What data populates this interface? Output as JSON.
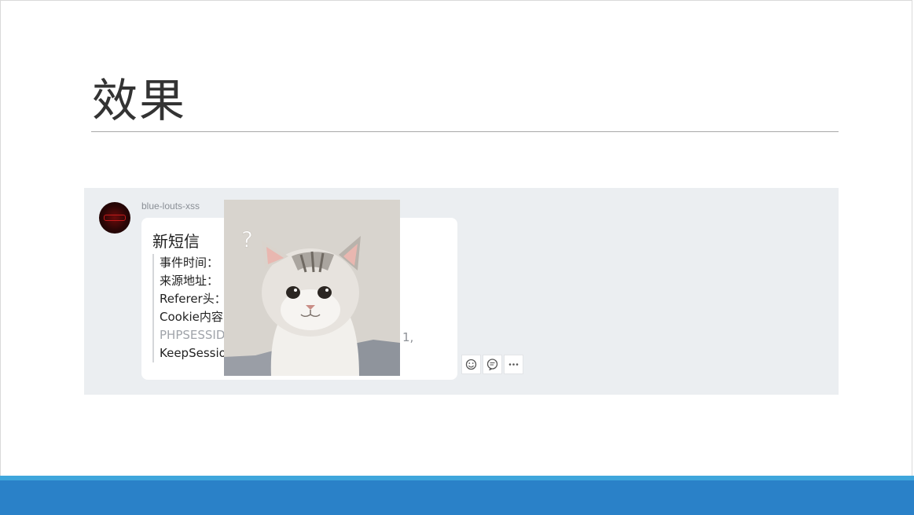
{
  "slide": {
    "title": "效果"
  },
  "chat": {
    "sender": "blue-louts-xss",
    "message": {
      "title": "新短信",
      "lines": [
        "事件时间：",
        "来源地址：",
        "Referer头：",
        "Cookie内容",
        "PHPSESSID",
        "KeepSessio"
      ],
      "trailing_text": "1,"
    },
    "actions": [
      {
        "name": "emoji-icon"
      },
      {
        "name": "reply-icon"
      },
      {
        "name": "more-icon"
      }
    ]
  },
  "colors": {
    "panel": "#ebeef1",
    "footer": "#2a81c8",
    "footer_accent": "#3fa6dc"
  }
}
